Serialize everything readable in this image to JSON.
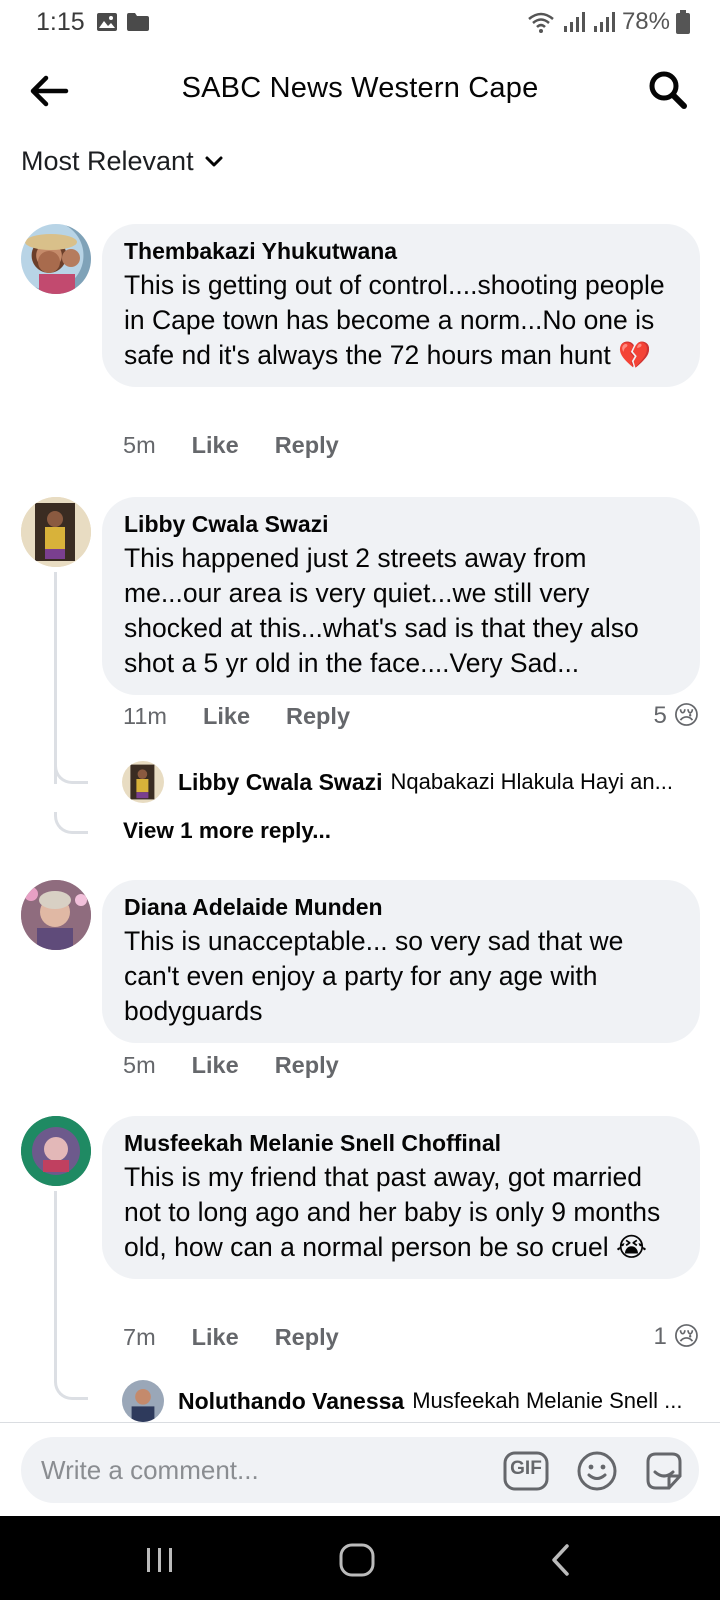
{
  "status": {
    "time": "1:15",
    "battery": "78%"
  },
  "header": {
    "title": "SABC News Western Cape"
  },
  "sort": {
    "label": "Most Relevant"
  },
  "comments": [
    {
      "author": "Thembakazi Yhukutwana",
      "text": "This is getting out of control....shooting people in Cape town has become a norm...No one is safe nd it's always the 72 hours man hunt 💔",
      "time": "5m",
      "like": "Like",
      "reply": "Reply"
    },
    {
      "author": "Libby Cwala Swazi",
      "text": "This happened just 2 streets away from me...our area is very quiet...we still very shocked at this...what's sad is that they also shot a 5 yr old in the face....Very Sad...",
      "time": "11m",
      "like": "Like",
      "reply": "Reply",
      "reaction_count": "5",
      "reaction_icon": "😢",
      "reply_preview": {
        "author": "Libby Cwala Swazi",
        "snippet": "Nqabakazi Hlakula Hayi an..."
      },
      "view_more": "View 1 more reply..."
    },
    {
      "author": "Diana Adelaide Munden",
      "text": "This is unacceptable... so very sad that we can't even enjoy a party for any age with bodyguards",
      "time": "5m",
      "like": "Like",
      "reply": "Reply"
    },
    {
      "author": "Musfeekah Melanie Snell Choffinal",
      "text": "This is my friend that past away, got married not to long ago and her baby is only 9 months old, how can a normal person be so cruel 😭",
      "time": "7m",
      "like": "Like",
      "reply": "Reply",
      "reaction_count": "1",
      "reaction_icon": "😢",
      "reply_preview": {
        "author": "Noluthando Vanessa",
        "snippet": "Musfeekah Melanie Snell ..."
      }
    }
  ],
  "composer": {
    "placeholder": "Write a comment...",
    "gif_label": "GIF"
  },
  "colors": {
    "bubble": "#f0f2f5",
    "meta": "#65676b",
    "text": "#050505",
    "nav": "#000000"
  }
}
